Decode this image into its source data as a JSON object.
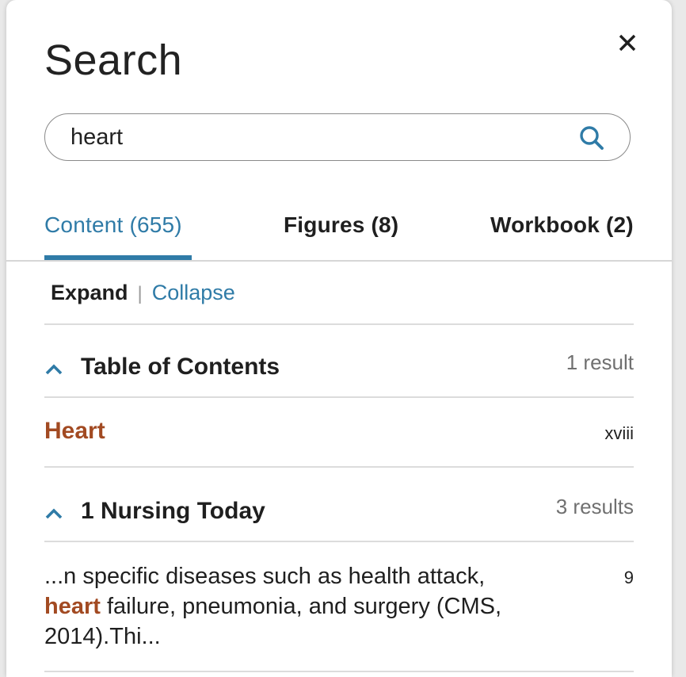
{
  "panel": {
    "title": "Search",
    "close_icon": "close-icon"
  },
  "search": {
    "value": "heart",
    "placeholder": "",
    "icon": "search-icon"
  },
  "tabs": [
    {
      "label": "Content (655)",
      "active": true
    },
    {
      "label": "Figures (8)",
      "active": false
    },
    {
      "label": "Workbook (2)",
      "active": false
    }
  ],
  "controls": {
    "expand_label": "Expand",
    "separator": "|",
    "collapse_label": "Collapse"
  },
  "sections": [
    {
      "title": "Table of Contents",
      "count": "1 result",
      "expanded": true,
      "results": [
        {
          "text": "Heart",
          "page": "xviii"
        }
      ]
    },
    {
      "title": "1 Nursing Today",
      "count": "3 results",
      "expanded": true,
      "results": [
        {
          "before": "...n specific diseases such as health attack,",
          "highlight": "heart",
          "after": "failure, pneumonia, and surgery (CMS, 2014).Thi...",
          "page": "9"
        }
      ]
    }
  ],
  "colors": {
    "accent": "#2f7ba7",
    "highlight": "#a24a22",
    "text": "#1f1f1f",
    "muted": "#707070"
  }
}
